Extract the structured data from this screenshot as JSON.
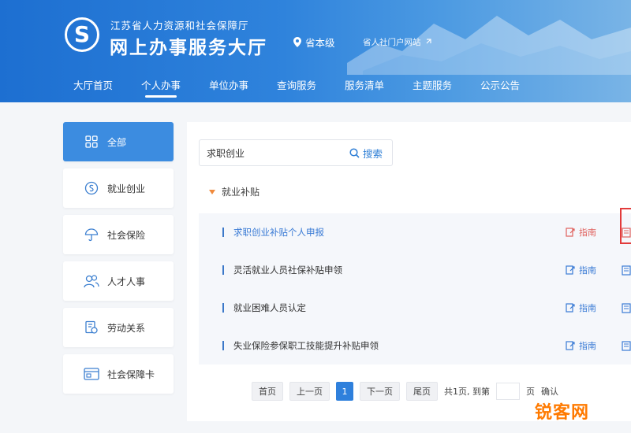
{
  "header": {
    "org_name": "江苏省人力资源和社会保障厅",
    "site_title": "网上办事服务大厅",
    "level": "省本级",
    "portal_link": "省人社门户网站",
    "logo_icon": "s-logo-icon"
  },
  "nav": {
    "items": [
      {
        "label": "大厅首页"
      },
      {
        "label": "个人办事"
      },
      {
        "label": "单位办事"
      },
      {
        "label": "查询服务"
      },
      {
        "label": "服务清单"
      },
      {
        "label": "主题服务"
      },
      {
        "label": "公示公告"
      }
    ],
    "active_index": 1
  },
  "sidebar": {
    "items": [
      {
        "label": "全部",
        "icon": "grid-icon"
      },
      {
        "label": "就业创业",
        "icon": "coin-icon"
      },
      {
        "label": "社会保险",
        "icon": "umbrella-icon"
      },
      {
        "label": "人才人事",
        "icon": "people-icon"
      },
      {
        "label": "劳动关系",
        "icon": "document-gear-icon"
      },
      {
        "label": "社会保障卡",
        "icon": "card-icon"
      }
    ]
  },
  "search": {
    "value": "求职创业",
    "button_label": "搜索"
  },
  "category": {
    "label": "就业补贴"
  },
  "list": {
    "rows": [
      {
        "label": "求职创业补贴个人申报",
        "guide": "指南"
      },
      {
        "label": "灵活就业人员社保补贴申领",
        "guide": "指南"
      },
      {
        "label": "就业困难人员认定",
        "guide": "指南"
      },
      {
        "label": "失业保险参保职工技能提升补贴申领",
        "guide": "指南"
      }
    ]
  },
  "pager": {
    "first": "首页",
    "prev": "上一页",
    "current": "1",
    "next": "下一页",
    "last": "尾页",
    "info": "共1页, 到第",
    "unit": "页",
    "confirm": "确认"
  },
  "watermark": "锐客网",
  "colors": {
    "header_blue": "#1d6fd1",
    "accent": "#3c8ce0",
    "guide_red": "#e0605c",
    "watermark": "#ff7a00"
  }
}
